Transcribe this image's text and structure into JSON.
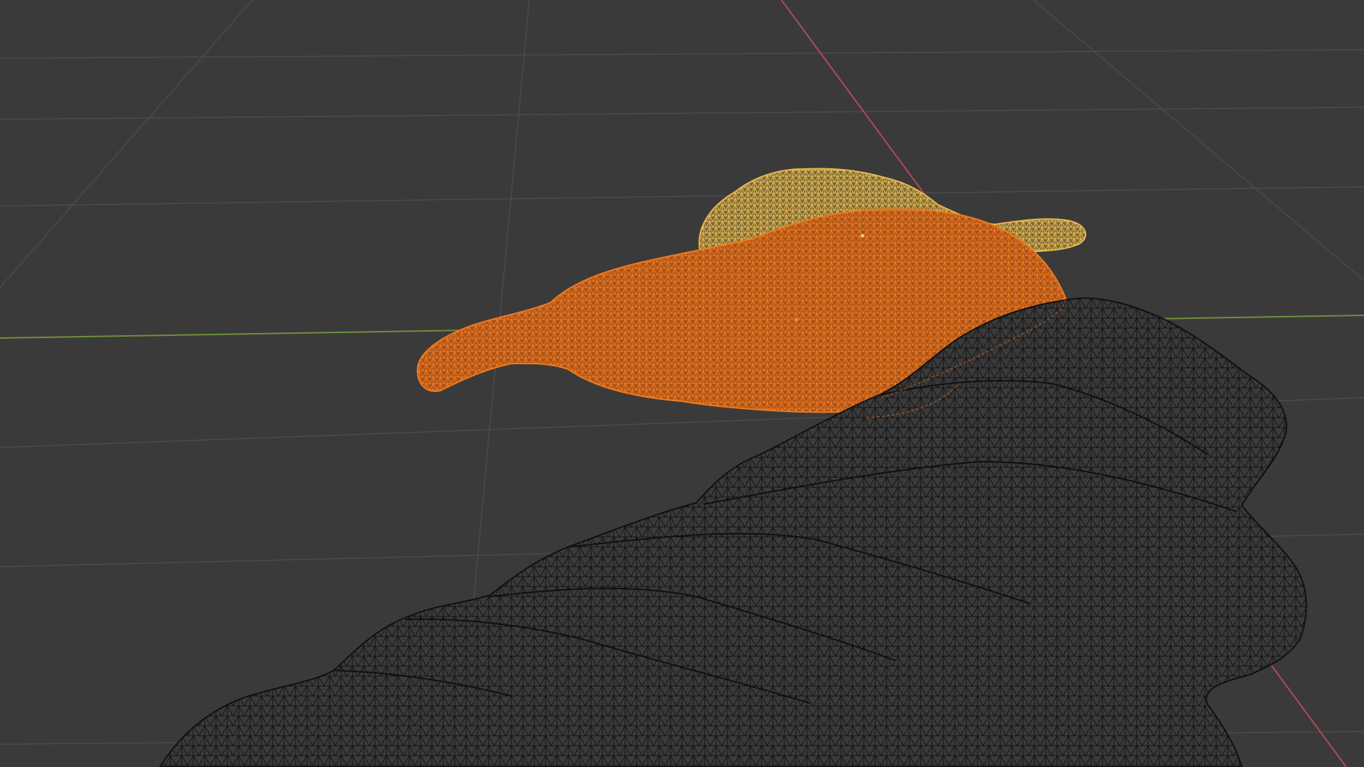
{
  "viewport": {
    "background_color": "#3a3a3a",
    "grid_color": "#4a4a4a",
    "x_axis_color": "#b04a5a",
    "y_axis_color": "#6f8f3a"
  },
  "objects": [
    {
      "name": "yellow-mesh",
      "state": "selected",
      "color": "#e8b54a"
    },
    {
      "name": "orange-mesh",
      "state": "active",
      "color": "#e8761e"
    },
    {
      "name": "dark-mesh",
      "state": "unselected",
      "color": "#111111"
    }
  ]
}
